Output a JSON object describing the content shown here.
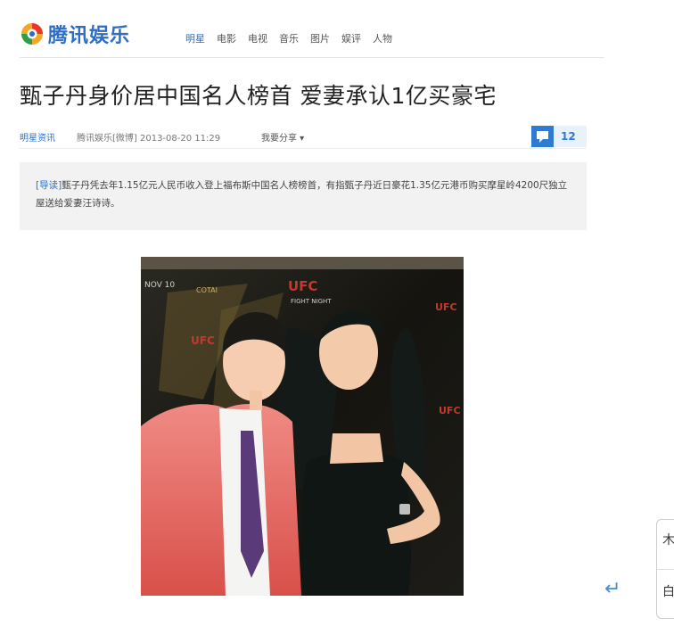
{
  "header": {
    "logo_text": "腾讯娱乐",
    "nav": [
      "明星",
      "电影",
      "电视",
      "音乐",
      "图片",
      "娱评",
      "人物"
    ]
  },
  "article": {
    "title": "甄子丹身价居中国名人榜首 爱妻承认1亿买豪宅",
    "category": "明星资讯",
    "source": "腾讯娱乐[微博] 2013-08-20 11:29",
    "share": "我要分享",
    "comment_count": "12",
    "summary_tag": "[导读]",
    "summary": "甄子丹凭去年1.15亿元人民币收入登上福布斯中国名人榜榜首，有指甄子丹近日豪花1.35亿元港币购买摩星岭4200尺独立屋送给爱妻汪诗诗。"
  },
  "photo": {
    "backdrop_texts": [
      "NOV 10",
      "COTAI",
      "UFC",
      "FIGHT NIGHT",
      "UFC",
      "UFC",
      "UFC"
    ]
  },
  "widget": {
    "glyphs": [
      "木",
      "白"
    ]
  },
  "colors": {
    "accent": "#2d6ec4",
    "comment": "#2f7bd3",
    "summary_bg": "#f2f2f2"
  },
  "icons": {
    "comment": "comment-icon",
    "return": "return-icon"
  }
}
